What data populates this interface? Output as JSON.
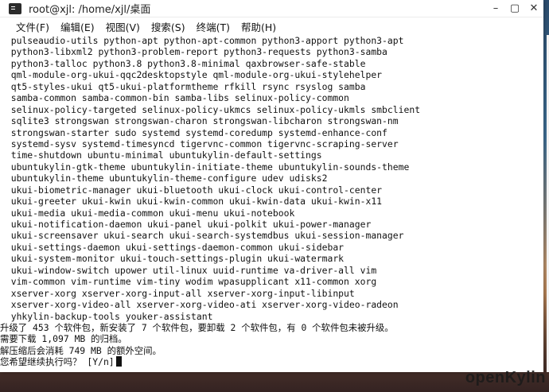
{
  "window": {
    "title": "root@xjl: /home/xjl/桌面",
    "controls": {
      "minimize": "–",
      "maximize": "▢",
      "close": "✕"
    }
  },
  "menubar": {
    "items": [
      {
        "label": "文件(F)"
      },
      {
        "label": "编辑(E)"
      },
      {
        "label": "视图(V)"
      },
      {
        "label": "搜索(S)"
      },
      {
        "label": "终端(T)"
      },
      {
        "label": "帮助(H)"
      }
    ]
  },
  "terminal": {
    "lines": [
      "  pulseaudio-utils python-apt python-apt-common python3-apport python3-apt",
      "  python3-libxml2 python3-problem-report python3-requests python3-samba",
      "  python3-talloc python3.8 python3.8-minimal qaxbrowser-safe-stable",
      "  qml-module-org-ukui-qqc2desktopstyle qml-module-org-ukui-stylehelper",
      "  qt5-styles-ukui qt5-ukui-platformtheme rfkill rsync rsyslog samba",
      "  samba-common samba-common-bin samba-libs selinux-policy-common",
      "  selinux-policy-targeted selinux-policy-ukmcs selinux-policy-ukmls smbclient",
      "  sqlite3 strongswan strongswan-charon strongswan-libcharon strongswan-nm",
      "  strongswan-starter sudo systemd systemd-coredump systemd-enhance-conf",
      "  systemd-sysv systemd-timesyncd tigervnc-common tigervnc-scraping-server",
      "  time-shutdown ubuntu-minimal ubuntukylin-default-settings",
      "  ubuntukylin-gtk-theme ubuntukylin-initiate-theme ubuntukylin-sounds-theme",
      "  ubuntukylin-theme ubuntukylin-theme-configure udev udisks2",
      "  ukui-biometric-manager ukui-bluetooth ukui-clock ukui-control-center",
      "  ukui-greeter ukui-kwin ukui-kwin-common ukui-kwin-data ukui-kwin-x11",
      "  ukui-media ukui-media-common ukui-menu ukui-notebook",
      "  ukui-notification-daemon ukui-panel ukui-polkit ukui-power-manager",
      "  ukui-screensaver ukui-search ukui-search-systemdbus ukui-session-manager",
      "  ukui-settings-daemon ukui-settings-daemon-common ukui-sidebar",
      "  ukui-system-monitor ukui-touch-settings-plugin ukui-watermark",
      "  ukui-window-switch upower util-linux uuid-runtime va-driver-all vim",
      "  vim-common vim-runtime vim-tiny wodim wpasupplicant x11-common xorg",
      "  xserver-xorg xserver-xorg-input-all xserver-xorg-input-libinput",
      "  xserver-xorg-video-all xserver-xorg-video-ati xserver-xorg-video-radeon",
      "  yhkylin-backup-tools youker-assistant",
      "升级了 453 个软件包，新安装了 7 个软件包，要卸载 2 个软件包，有 0 个软件包未被升级。",
      "需要下载 1,097 MB 的归档。",
      "解压缩后会消耗 749 MB 的额外空间。"
    ],
    "prompt": "您希望继续执行吗？ [Y/n]"
  },
  "desktop": {
    "watermark": "openKylin"
  }
}
